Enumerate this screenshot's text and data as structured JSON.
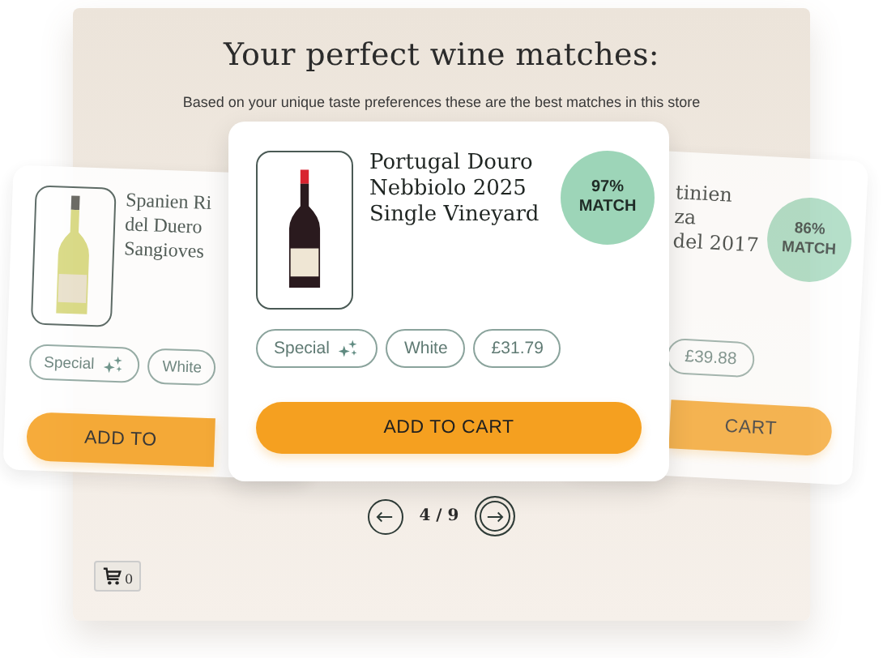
{
  "heading": "Your perfect wine matches:",
  "subheading": "Based on your unique taste preferences these are the best matches in this store",
  "cards": [
    {
      "kind": "left",
      "bottle": {
        "kind": "white"
      },
      "title_lines": [
        "Spanien Ri",
        "del Duero",
        "Sangioves"
      ],
      "tags": [
        {
          "label": "Special",
          "sparkle": true
        },
        {
          "label": "White",
          "sparkle": false
        }
      ],
      "button": "ADD TO"
    },
    {
      "kind": "right",
      "title_lines": [
        "tinien",
        "za",
        "del 2017"
      ],
      "match": [
        "86%",
        "MATCH"
      ],
      "tags": [
        {
          "label": "£39.88",
          "sparkle": false
        }
      ],
      "button": "CART"
    },
    {
      "kind": "center",
      "bottle": {
        "kind": "red"
      },
      "title_lines": [
        "Portugal Douro",
        "Nebbiolo 2025",
        "Single Vineyard"
      ],
      "match": [
        "97%",
        "MATCH"
      ],
      "tags": [
        {
          "label": "Special",
          "sparkle": true
        },
        {
          "label": "White",
          "sparkle": false
        },
        {
          "label": "£31.79",
          "sparkle": false
        }
      ],
      "button": "ADD TO CART"
    }
  ],
  "pager": {
    "text": "4 / 9"
  },
  "cart": {
    "count": "0"
  }
}
